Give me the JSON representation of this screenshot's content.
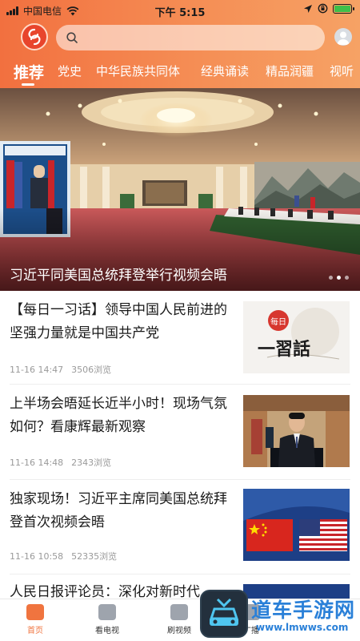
{
  "status_bar": {
    "carrier": "中国电信",
    "time": "下午 5:15"
  },
  "search": {
    "placeholder": ""
  },
  "tabs": [
    {
      "label": "推荐",
      "active": true
    },
    {
      "label": "党史"
    },
    {
      "label": "中华民族共同体"
    },
    {
      "label": "经典诵读"
    },
    {
      "label": "精品润疆"
    },
    {
      "label": "视听"
    }
  ],
  "hero": {
    "caption": "习近平同美国总统拜登举行视频会晤",
    "slides": 3,
    "active_slide": 2
  },
  "articles": [
    {
      "title": "【每日一习话】领导中国人民前进的坚强力量就是中国共产党",
      "date": "11-16 14:47",
      "views": "3506浏览",
      "thumb_text_small": "每日",
      "thumb_text_big": "一習話"
    },
    {
      "title": "上半场会晤延长近半小时！现场气氛如何？看康辉最新观察",
      "date": "11-16 14:48",
      "views": "2343浏览"
    },
    {
      "title": "独家现场！习近平主席同美国总统拜登首次视频会晤",
      "date": "11-16 10:58",
      "views": "52335浏览"
    },
    {
      "title": "人民日报评论员：深化对新时代"
    }
  ],
  "bottom_nav": [
    {
      "label": "首页",
      "active": true
    },
    {
      "label": "看电视"
    },
    {
      "label": "刷视频"
    },
    {
      "label": "广播"
    }
  ],
  "watermark": {
    "text": "道车手游网",
    "url": "www.lmwws.com"
  },
  "colors": {
    "header_start": "#f2703f",
    "header_end": "#f6a265",
    "accent": "#f0743f",
    "watermark": "#2a80d8"
  }
}
